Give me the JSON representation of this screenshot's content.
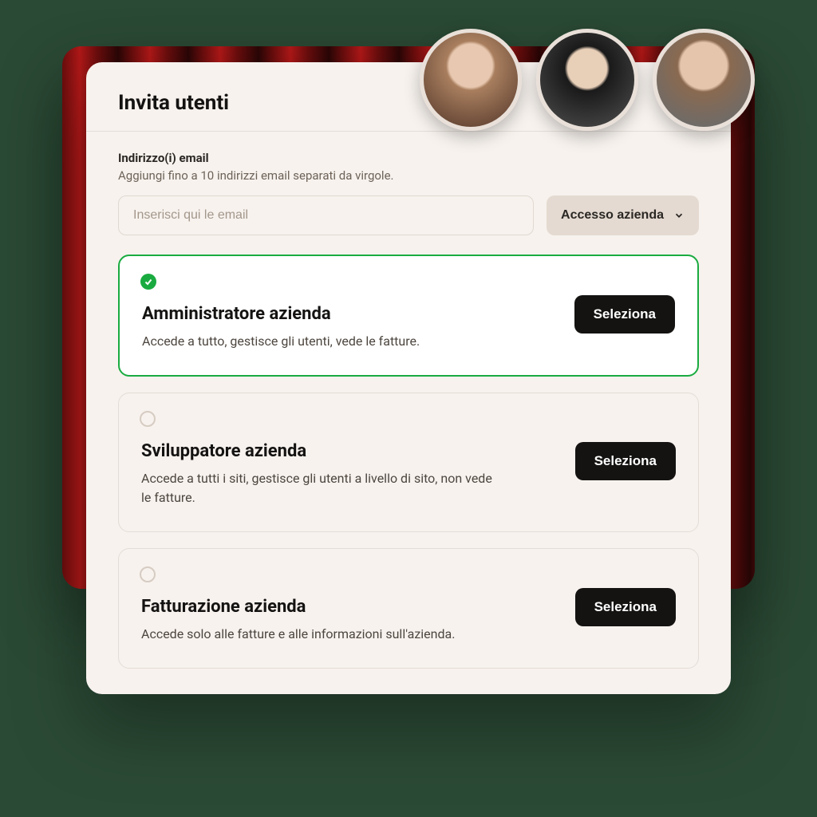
{
  "header": {
    "title": "Invita utenti"
  },
  "email": {
    "label": "Indirizzo(i) email",
    "sub": "Aggiungi fino a 10 indirizzi email separati da virgole.",
    "placeholder": "Inserisci qui le email"
  },
  "access_select": {
    "label": "Accesso azienda"
  },
  "roles": [
    {
      "title": "Amministratore azienda",
      "desc": "Accede a tutto, gestisce gli utenti, vede le fatture.",
      "button": "Seleziona",
      "selected": true
    },
    {
      "title": "Sviluppatore azienda",
      "desc": "Accede a tutti i siti, gestisce gli utenti a livello di sito, non vede le fatture.",
      "button": "Seleziona",
      "selected": false
    },
    {
      "title": "Fatturazione azienda",
      "desc": "Accede solo alle fatture e alle informazioni sull'azienda.",
      "button": "Seleziona",
      "selected": false
    }
  ]
}
